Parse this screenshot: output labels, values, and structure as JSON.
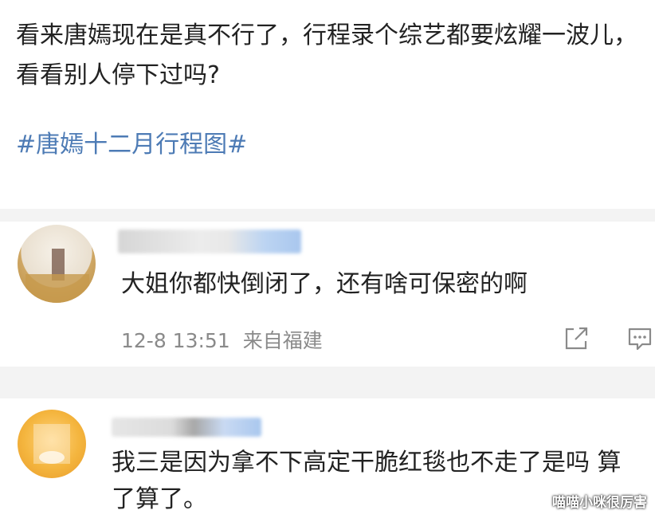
{
  "post": {
    "text": "看来唐嫣现在是真不行了，行程录个综艺都要炫耀一波儿，看看别人停下过吗?",
    "hashtag": "#唐嫣十二月行程图#"
  },
  "comments": [
    {
      "text": "大姐你都快倒闭了，还有啥可保密的啊",
      "time": "12-8 13:51",
      "source": "来自福建"
    },
    {
      "text_line1": "我三是因为拿不下高定干脆红毯也不走了是吗 算",
      "text_line2": "了算了。"
    }
  ],
  "watermark": "喵喵小咪很厉害",
  "colors": {
    "hashtag": "#4d7bb5",
    "meta": "#8a8a8a",
    "divider": "#f3f3f3"
  },
  "icons": [
    "share-icon",
    "comment-icon"
  ]
}
